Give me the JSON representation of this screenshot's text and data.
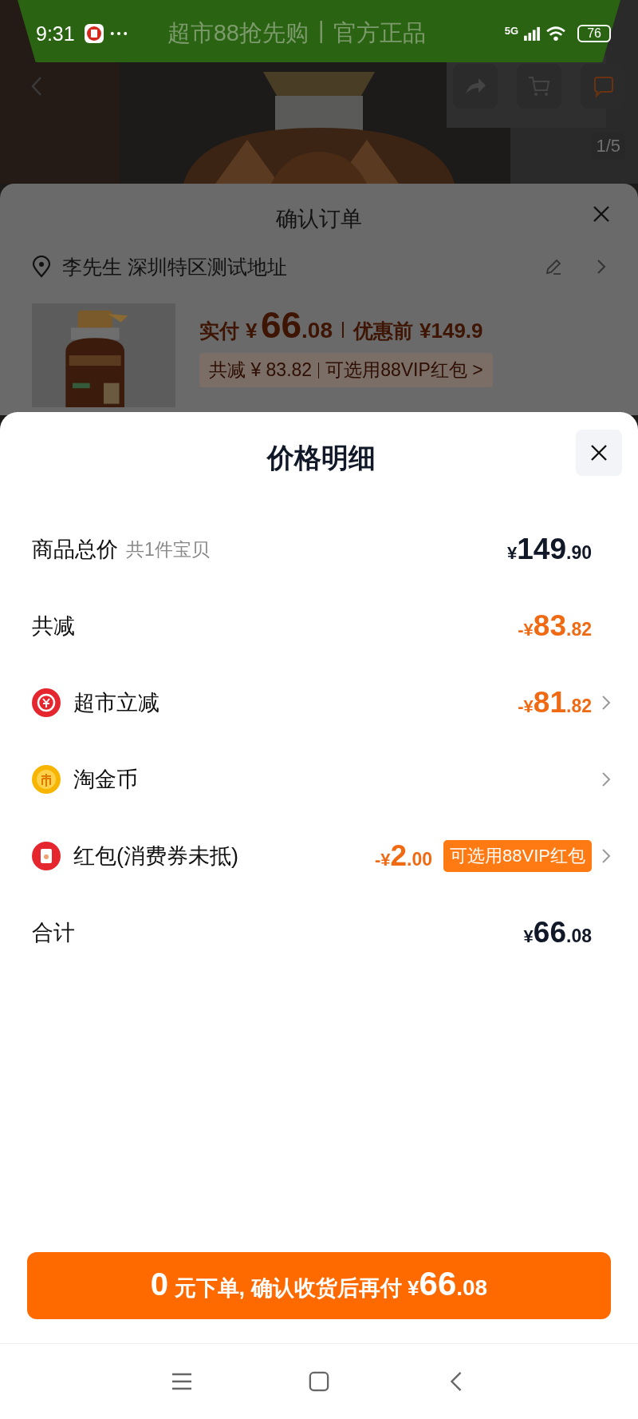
{
  "status_bar": {
    "time": "9:31",
    "network": "5G",
    "battery": "76"
  },
  "banner": {
    "texts": [
      "超市88抢先购",
      "|",
      "官方正品"
    ]
  },
  "product_page": {
    "image_counter": "1/5"
  },
  "order_sheet": {
    "title": "确认订单",
    "address": "李先生 深圳特区测试地址",
    "paid_label": "实付",
    "paid": {
      "prefix": "¥",
      "integer": "66",
      "decimal": ".08"
    },
    "original_label": "优惠前",
    "original": "¥149.9",
    "saving": "共减 ¥ 83.82",
    "saving_link": "可选用88VIP红包 >"
  },
  "price_detail": {
    "title": "价格明细",
    "rows": [
      {
        "kind": "plain",
        "label": "商品总价",
        "note": "共1件宝贝",
        "amount": {
          "prefix": "¥",
          "integer": "149",
          "decimal": ".90"
        },
        "color": "#111827",
        "chevron": false
      },
      {
        "kind": "plain",
        "label": "共减",
        "amount": {
          "prefix": "-¥",
          "integer": "83",
          "decimal": ".82"
        },
        "color": "#f06a14",
        "chevron": false
      },
      {
        "kind": "discount",
        "label": "超市立减",
        "amount": {
          "prefix": "-¥",
          "integer": "81",
          "decimal": ".82"
        },
        "color": "#f06a14",
        "chevron": true
      },
      {
        "kind": "coin",
        "label": "淘金币",
        "chevron": true
      },
      {
        "kind": "packet",
        "label": "红包(消费券未抵)",
        "amount": {
          "prefix": "-¥",
          "integer": "2",
          "decimal": ".00"
        },
        "badge": "可选用88VIP红包",
        "color": "#f06a14",
        "chevron": true
      },
      {
        "kind": "plain",
        "label": "合计",
        "amount": {
          "prefix": "¥",
          "integer": "66",
          "decimal": ".08"
        },
        "color": "#111827",
        "chevron": false
      }
    ]
  },
  "submit_button": {
    "lead": "0",
    "text": "元下单, 确认收货后再付",
    "prefix": "¥",
    "integer": "66",
    "decimal": ".08"
  }
}
